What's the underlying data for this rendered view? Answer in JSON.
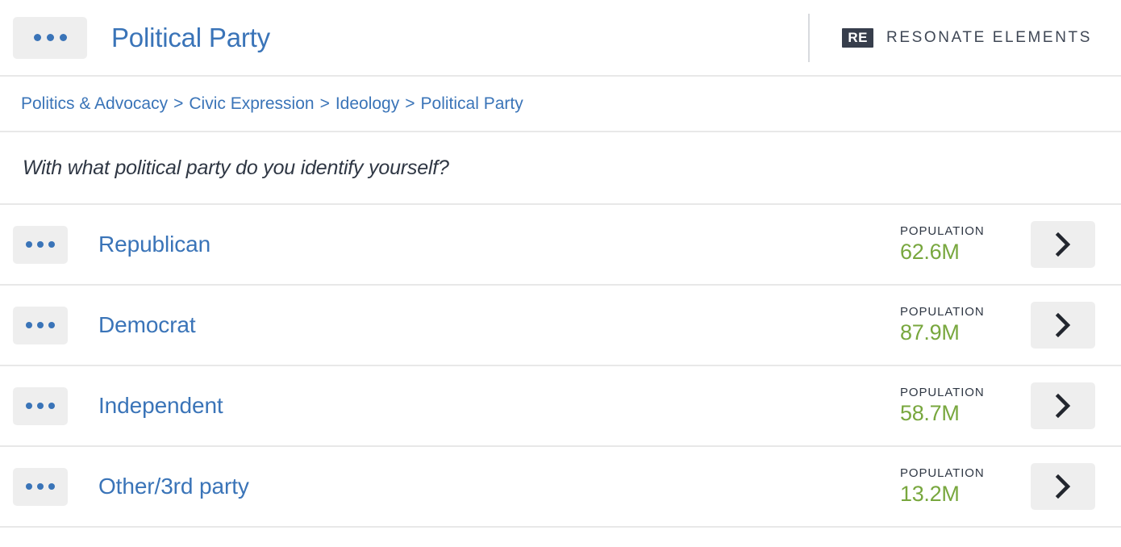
{
  "header": {
    "menu_icon": "ellipsis-icon",
    "title": "Political Party",
    "brand_mark": "RE",
    "brand_name": "RESONATE ELEMENTS"
  },
  "breadcrumb": {
    "separator": ">",
    "items": [
      {
        "label": "Politics & Advocacy"
      },
      {
        "label": "Civic Expression"
      },
      {
        "label": "Ideology"
      },
      {
        "label": "Political Party"
      }
    ]
  },
  "question": {
    "text": "With what political party do you identify yourself?"
  },
  "rows": {
    "population_label": "POPULATION",
    "chevron_icon": "chevron-right-icon",
    "menu_icon": "ellipsis-icon",
    "items": [
      {
        "label": "Republican",
        "population": "62.6M"
      },
      {
        "label": "Democrat",
        "population": "87.9M"
      },
      {
        "label": "Independent",
        "population": "58.7M"
      },
      {
        "label": "Other/3rd party",
        "population": "13.2M"
      }
    ]
  },
  "colors": {
    "link_blue": "#3a74b8",
    "value_green": "#78a73e",
    "dark_navy": "#2f3744",
    "brand_box": "#373e4c",
    "button_gray": "#eeeeee",
    "divider": "#e8e8e8"
  }
}
